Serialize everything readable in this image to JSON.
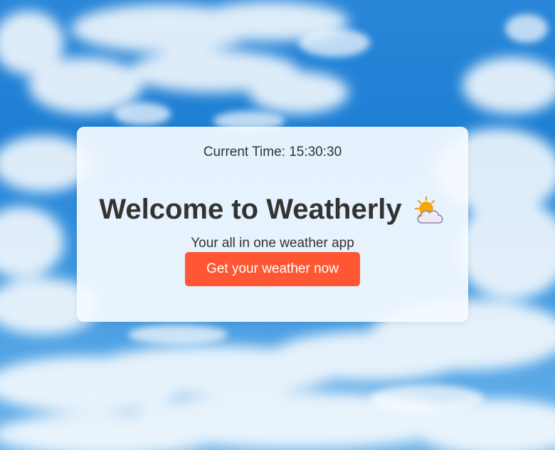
{
  "background": {
    "sky_color": "#2a86d8",
    "cloud_color": "#ffffff"
  },
  "card": {
    "time_label": "Current Time:",
    "time_value": "15:30:30",
    "title": "Welcome to Weatherly",
    "title_icon": "sun-behind-cloud-icon",
    "subtitle": "Your all in one weather app",
    "cta_label": "Get your weather now",
    "cta_color": "#ff5733"
  }
}
